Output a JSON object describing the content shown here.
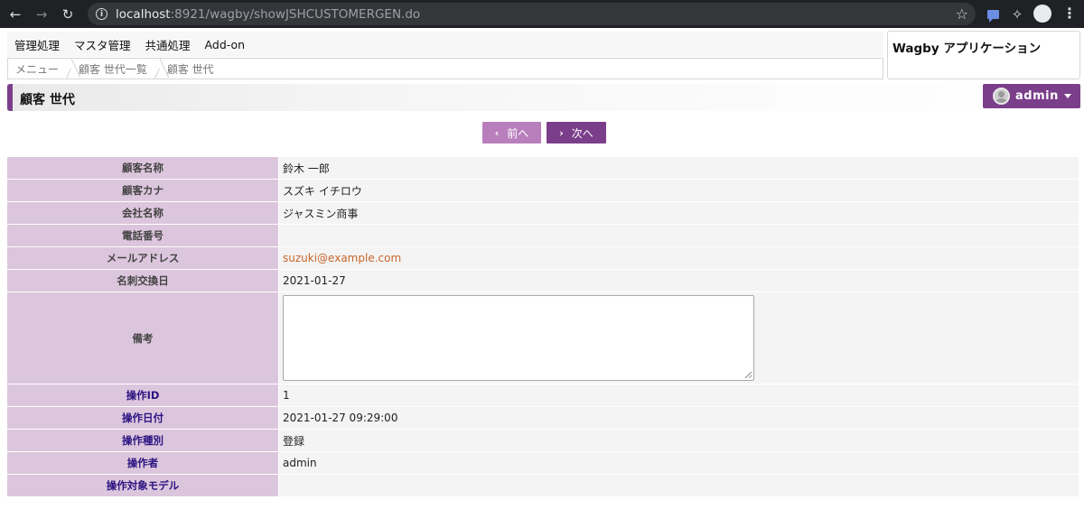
{
  "browser": {
    "url_host": "localhost",
    "url_rest": ":8921/wagby/showJSHCUSTOMERGEN.do"
  },
  "menu": {
    "items": [
      "管理処理",
      "マスタ管理",
      "共通処理",
      "Add-on"
    ]
  },
  "breadcrumb": {
    "items": [
      "メニュー",
      "顧客 世代一覧",
      "顧客 世代"
    ]
  },
  "app_title": "Wagby アプリケーション",
  "page": {
    "title": "顧客 世代"
  },
  "user": {
    "name": "admin"
  },
  "pager": {
    "prev_label": "前へ",
    "next_label": "次へ"
  },
  "fields": [
    {
      "label": "顧客名称",
      "value": "鈴木 一郎"
    },
    {
      "label": "顧客カナ",
      "value": "スズキ イチロウ"
    },
    {
      "label": "会社名称",
      "value": "ジャスミン商事"
    },
    {
      "label": "電話番号",
      "value": ""
    },
    {
      "label": "メールアドレス",
      "value": "suzuki@example.com"
    },
    {
      "label": "名刺交換日",
      "value": "2021-01-27"
    },
    {
      "label": "備考",
      "value": ""
    },
    {
      "label": "操作ID",
      "value": "1"
    },
    {
      "label": "操作日付",
      "value": "2021-01-27 09:29:00"
    },
    {
      "label": "操作種別",
      "value": "登録"
    },
    {
      "label": "操作者",
      "value": "admin"
    },
    {
      "label": "操作対象モデル",
      "value": ""
    }
  ],
  "colors": {
    "accent": "#7b3e8a",
    "prev_button": "#b97fbd",
    "label_bg": "#dcc6dd",
    "system_label_text": "#2b1380",
    "link": "#c8662a"
  }
}
